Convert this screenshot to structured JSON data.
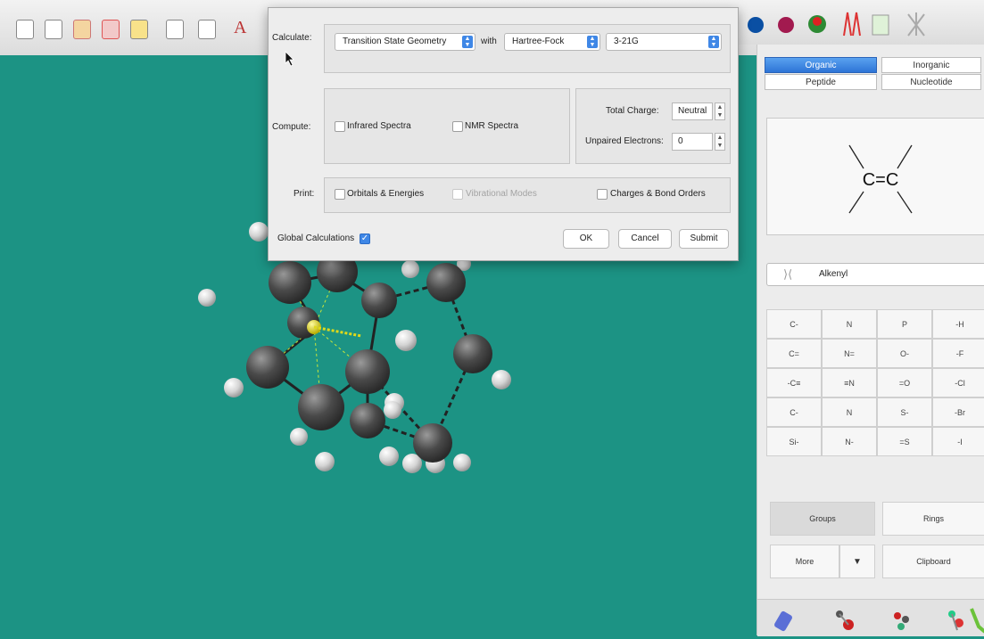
{
  "toolbar": {
    "left_icons": [
      "new-document-icon",
      "open-document-icon",
      "add-fragment-icon",
      "delete-icon",
      "minimize-icon",
      "calculation-icon",
      "display-icon"
    ],
    "text_icon_label": "A",
    "right_icons": [
      "orbital-icon",
      "surface-icon",
      "potential-map-icon",
      "spectra-icon",
      "spreadsheet-icon",
      "properties-icon"
    ]
  },
  "dialog": {
    "calculate_label": "Calculate:",
    "calc_type": "Transition State Geometry",
    "with_label": "with",
    "method": "Hartree-Fock",
    "basis_set": "3-21G",
    "compute_label": "Compute:",
    "infrared_label": "Infrared Spectra",
    "nmr_label": "NMR Spectra",
    "total_charge_label": "Total Charge:",
    "total_charge_value": "Neutral",
    "unpaired_label": "Unpaired Electrons:",
    "unpaired_value": "0",
    "print_label": "Print:",
    "orbitals_label": "Orbitals & Energies",
    "vibrational_label": "Vibrational Modes",
    "charges_label": "Charges & Bond Orders",
    "global_label": "Global Calculations",
    "ok_label": "OK",
    "cancel_label": "Cancel",
    "submit_label": "Submit"
  },
  "sidebar": {
    "tabs": [
      "Organic",
      "Inorganic",
      "Peptide",
      "Nucleotide"
    ],
    "active_tab": "Organic",
    "preview_text": "C=C",
    "fragment_select": "Alkenyl",
    "fragments": [
      [
        "C-",
        "N",
        "P",
        "-H"
      ],
      [
        "C=",
        "N=",
        "O-",
        "-F"
      ],
      [
        "-C≡",
        "≡N",
        "=O",
        "-Cl"
      ],
      [
        "C-",
        "N",
        "S-",
        "-Br"
      ],
      [
        "Si-",
        "N-",
        "=S",
        "-I"
      ]
    ],
    "groups_label": "Groups",
    "rings_label": "Rings",
    "more_label": "More",
    "clipboard_label": "Clipboard"
  },
  "colors": {
    "viewport_bg": "#1c9384",
    "carbon": "#4a4a4a",
    "hydrogen": "#e6e6e6",
    "metal": "#e9e21f",
    "accent": "#3f87e6"
  }
}
